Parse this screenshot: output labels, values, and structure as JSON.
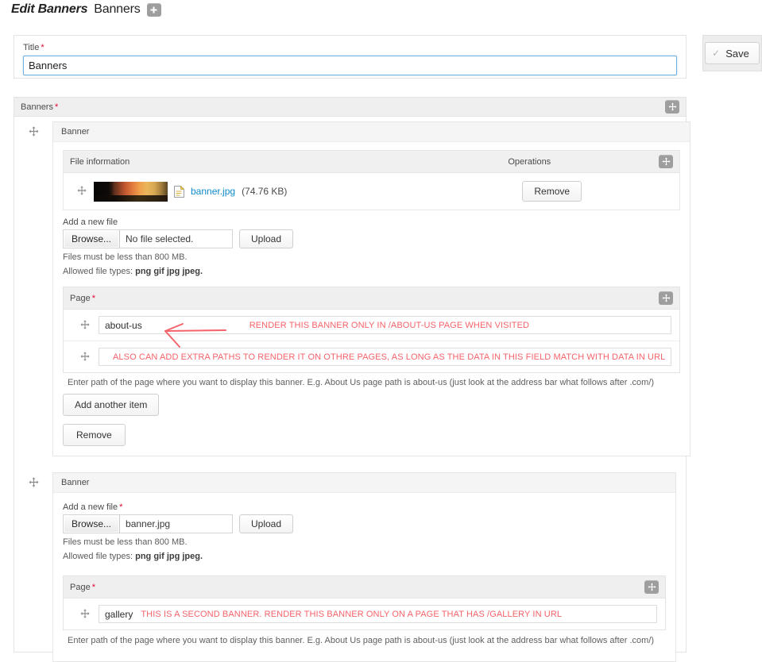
{
  "header": {
    "context_title": "Edit Banners",
    "page_title": "Banners",
    "add_icon": "plus-icon"
  },
  "save_box": {
    "check_icon": "check-icon",
    "label": "Save"
  },
  "title_field": {
    "label": "Title",
    "required_mark": "*",
    "value": "Banners"
  },
  "banners_section": {
    "label": "Banners",
    "required_mark": "*",
    "drag_icon": "drag-handle-icon"
  },
  "banner_items": [
    {
      "card_title": "Banner",
      "drag_icon": "drag-handle-icon",
      "file_table": {
        "header_info": "File information",
        "header_operations": "Operations",
        "drag_icon": "drag-handle-icon",
        "row": {
          "row_drag_icon": "drag-handle-icon",
          "thumbnail": "banner-thumbnail",
          "file_icon": "file-document-icon",
          "file_name": "banner.jpg",
          "file_size": "(74.76 KB)",
          "remove_label": "Remove"
        }
      },
      "upload": {
        "label": "Add a new file",
        "required_mark": "",
        "browse_label": "Browse...",
        "file_value": "No file selected.",
        "upload_label": "Upload",
        "hint_size": "Files must be less than 800 MB.",
        "hint_types_prefix": "Allowed file types:",
        "hint_types_value": "png gif jpg jpeg."
      },
      "page_fieldset": {
        "label": "Page",
        "required_mark": "*",
        "drag_icon": "drag-handle-icon",
        "rows": [
          {
            "drag_icon": "drag-handle-icon",
            "value": "about-us",
            "annotation": "RENDER THIS BANNER ONLY IN /ABOUT-US PAGE WHEN VISITED",
            "annotation_centered": false
          },
          {
            "drag_icon": "drag-handle-icon",
            "value": "",
            "annotation": "ALSO CAN ADD EXTRA PATHS TO RENDER IT ON OTHRE PAGES, AS LONG AS THE DATA IN THIS FIELD MATCH WITH DATA IN URL",
            "annotation_centered": true
          }
        ],
        "help": "Enter path of the page where you want to display this banner. E.g. About Us page path is about-us (just look at the address bar what follows after .com/)",
        "add_another_label": "Add another item"
      },
      "remove_label": "Remove"
    },
    {
      "card_title": "Banner",
      "drag_icon": "drag-handle-icon",
      "upload": {
        "label": "Add a new file",
        "required_mark": "*",
        "browse_label": "Browse...",
        "file_value": "banner.jpg",
        "upload_label": "Upload",
        "hint_size": "Files must be less than 800 MB.",
        "hint_types_prefix": "Allowed file types:",
        "hint_types_value": "png gif jpg jpeg."
      },
      "page_fieldset": {
        "label": "Page",
        "required_mark": "*",
        "drag_icon": "drag-handle-icon",
        "rows": [
          {
            "drag_icon": "drag-handle-icon",
            "value": "gallery",
            "annotation": "THIS IS A SECOND BANNER. RENDER THIS BANNER ONLY ON  A PAGE THAT HAS /GALLERY IN URL",
            "annotation_centered": false
          }
        ],
        "help": "Enter path of the page where you want to display this banner. E.g. About Us page path is about-us (just look at the address bar what follows after .com/)"
      }
    }
  ],
  "colors": {
    "annotation_red": "#f4636a",
    "link_blue": "#0e8ac8",
    "required_red": "#e2062c",
    "focus_blue": "#6fb2e0"
  }
}
